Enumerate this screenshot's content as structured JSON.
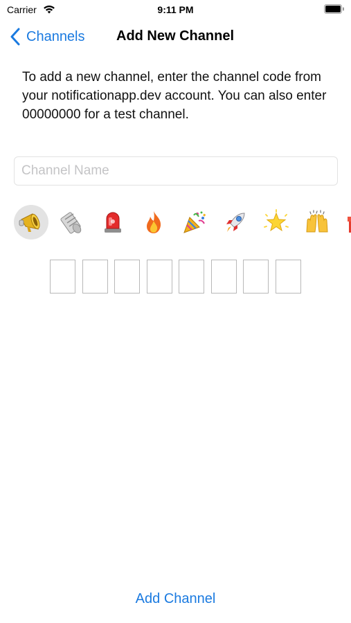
{
  "status_bar": {
    "carrier": "Carrier",
    "time": "9:11 PM"
  },
  "nav": {
    "back_label": "Channels",
    "title": "Add New Channel"
  },
  "instructions": "To add a new channel, enter the channel code from your notificationapp.dev account. You can also enter 00000000 for a test channel.",
  "channel_name_field": {
    "value": "",
    "placeholder": "Channel Name"
  },
  "emoji_options": {
    "items": [
      "megaphone",
      "newspaper",
      "police-light",
      "fire",
      "party-popper",
      "rocket",
      "glowing-star",
      "raising-hands",
      "gift"
    ],
    "selected": "megaphone"
  },
  "code_boxes": {
    "count": 8,
    "values": [
      "",
      "",
      "",
      "",
      "",
      "",
      "",
      ""
    ]
  },
  "add_button_label": "Add Channel",
  "colors": {
    "accent": "#1a7ae0",
    "placeholder": "#c4c4c6",
    "selected_emoji_bg": "#e3e3e3",
    "code_box_border": "#b8b8b8"
  }
}
